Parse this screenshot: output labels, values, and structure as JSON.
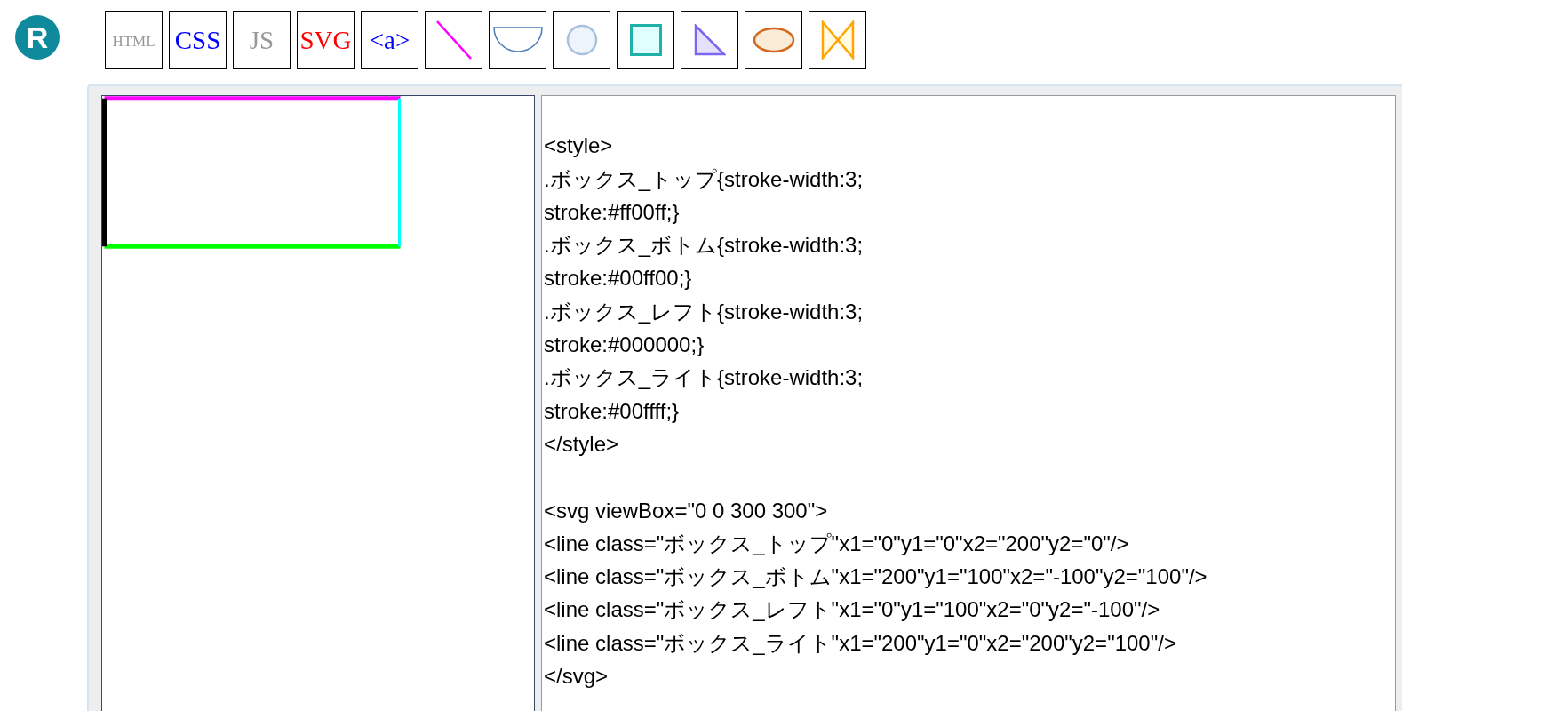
{
  "logo": {
    "letter": "R"
  },
  "toolbar": [
    {
      "kind": "text",
      "label": "HTML",
      "color": "#999999"
    },
    {
      "kind": "text",
      "label": "CSS",
      "color": "#0000ff"
    },
    {
      "kind": "text",
      "label": "JS",
      "color": "#999999"
    },
    {
      "kind": "text",
      "label": "SVG",
      "color": "#ff0000"
    },
    {
      "kind": "text",
      "label": "<a>",
      "color": "#0000ff"
    },
    {
      "kind": "icon"
    },
    {
      "kind": "icon"
    },
    {
      "kind": "icon"
    },
    {
      "kind": "icon"
    },
    {
      "kind": "icon"
    },
    {
      "kind": "icon"
    },
    {
      "kind": "icon"
    }
  ],
  "editor": {
    "code_blocks": [
      [
        "<style>",
        ".ボックス_トップ{stroke-width:3;",
        "stroke:#ff00ff;}",
        ".ボックス_ボトム{stroke-width:3;",
        "stroke:#00ff00;}",
        ".ボックス_レフト{stroke-width:3;",
        "stroke:#000000;}",
        ".ボックス_ライト{stroke-width:3;",
        "stroke:#00ffff;}",
        "</style>"
      ],
      [
        "<svg viewBox=\"0 0 300 300\">",
        "<line class=\"ボックス_トップ\"x1=\"0\"y1=\"0\"x2=\"200\"y2=\"0\"/>",
        "<line class=\"ボックス_ボトム\"x1=\"200\"y1=\"100\"x2=\"-100\"y2=\"100\"/>",
        "<line class=\"ボックス_レフト\"x1=\"0\"y1=\"100\"x2=\"0\"y2=\"-100\"/>",
        "<line class=\"ボックス_ライト\"x1=\"200\"y1=\"0\"x2=\"200\"y2=\"100\"/>",
        "</svg>"
      ]
    ]
  }
}
